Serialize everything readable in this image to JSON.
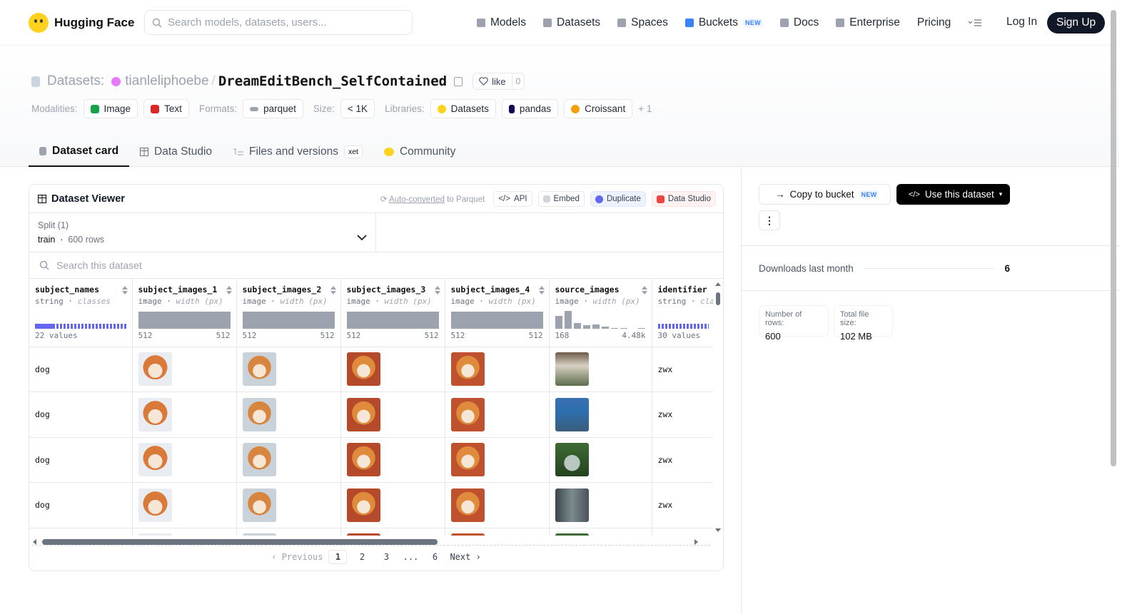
{
  "nav": {
    "brand": "Hugging Face",
    "search_placeholder": "Search models, datasets, users...",
    "links": [
      "Models",
      "Datasets",
      "Spaces",
      "Buckets",
      "Docs",
      "Enterprise",
      "Pricing"
    ],
    "new_badge": "NEW",
    "login": "Log In",
    "signup": "Sign Up"
  },
  "header": {
    "datasets_label": "Datasets:",
    "owner": "tianleliphoebe",
    "name": "DreamEditBench_SelfContained",
    "like_label": "like",
    "like_count": "0",
    "modalities_label": "Modalities:",
    "modalities": [
      "Image",
      "Text"
    ],
    "formats_label": "Formats:",
    "format": "parquet",
    "size_label": "Size:",
    "size": "< 1K",
    "libraries_label": "Libraries:",
    "libraries": [
      "Datasets",
      "pandas",
      "Croissant"
    ],
    "more_libraries": "+ 1"
  },
  "tabs": [
    "Dataset card",
    "Data Studio",
    "Files and versions",
    "Community"
  ],
  "xet_badge": "xet",
  "viewer": {
    "title": "Dataset Viewer",
    "auto_converted": "Auto-converted",
    "to_parquet": "to Parquet",
    "buttons": [
      "API",
      "Embed",
      "Duplicate",
      "Data Studio"
    ],
    "split_label": "Split (1)",
    "split_name": "train",
    "split_rows": "600 rows",
    "search_placeholder": "Search this dataset",
    "columns": [
      {
        "name": "subject_names",
        "type": "string",
        "sub": "classes",
        "summary": "22 values"
      },
      {
        "name": "subject_images_1",
        "type": "image",
        "sub": "width (px)",
        "min": "512",
        "max": "512"
      },
      {
        "name": "subject_images_2",
        "type": "image",
        "sub": "width (px)",
        "min": "512",
        "max": "512"
      },
      {
        "name": "subject_images_3",
        "type": "image",
        "sub": "width (px)",
        "min": "512",
        "max": "512"
      },
      {
        "name": "subject_images_4",
        "type": "image",
        "sub": "width (px)",
        "min": "512",
        "max": "512"
      },
      {
        "name": "source_images",
        "type": "image",
        "sub": "width (px)",
        "min": "168",
        "max": "4.48k"
      },
      {
        "name": "identifier",
        "type": "string",
        "sub": "cla",
        "summary": "30 values"
      }
    ],
    "rows": [
      {
        "subject": "dog",
        "identifier": "zwx"
      },
      {
        "subject": "dog",
        "identifier": "zwx"
      },
      {
        "subject": "dog",
        "identifier": "zwx"
      },
      {
        "subject": "dog",
        "identifier": "zwx"
      }
    ],
    "pager": {
      "prev": "Previous",
      "pages": [
        "1",
        "2",
        "3",
        "...",
        "6"
      ],
      "next": "Next",
      "current": "1"
    }
  },
  "sidebar": {
    "copy_to_bucket": "Copy to bucket",
    "new_badge": "NEW",
    "use_dataset": "Use this dataset",
    "downloads_label": "Downloads last month",
    "downloads": "6",
    "rows_label": "Number of rows:",
    "rows": "600",
    "filesize_label": "Total file size:",
    "filesize": "102 MB"
  },
  "colors": {
    "accent": "#111827",
    "class_bar": "#6366f1",
    "brand": "#ffd21e"
  }
}
